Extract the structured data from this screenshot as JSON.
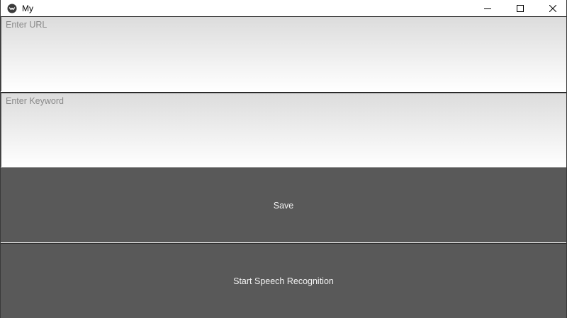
{
  "window": {
    "title": "My",
    "app_icon": "app-logo-icon",
    "controls": {
      "minimize_icon": "minimize-icon",
      "maximize_icon": "maximize-icon",
      "close_icon": "close-icon"
    }
  },
  "form": {
    "url_field": {
      "placeholder": "Enter URL",
      "value": ""
    },
    "keyword_field": {
      "placeholder": "Enter Keyword",
      "value": ""
    },
    "save_button": {
      "label": "Save"
    },
    "speech_button": {
      "label": "Start Speech Recognition"
    }
  },
  "colors": {
    "button_bg": "#595959",
    "button_text": "#f2f2f2",
    "placeholder_text": "#8a8a8a"
  }
}
